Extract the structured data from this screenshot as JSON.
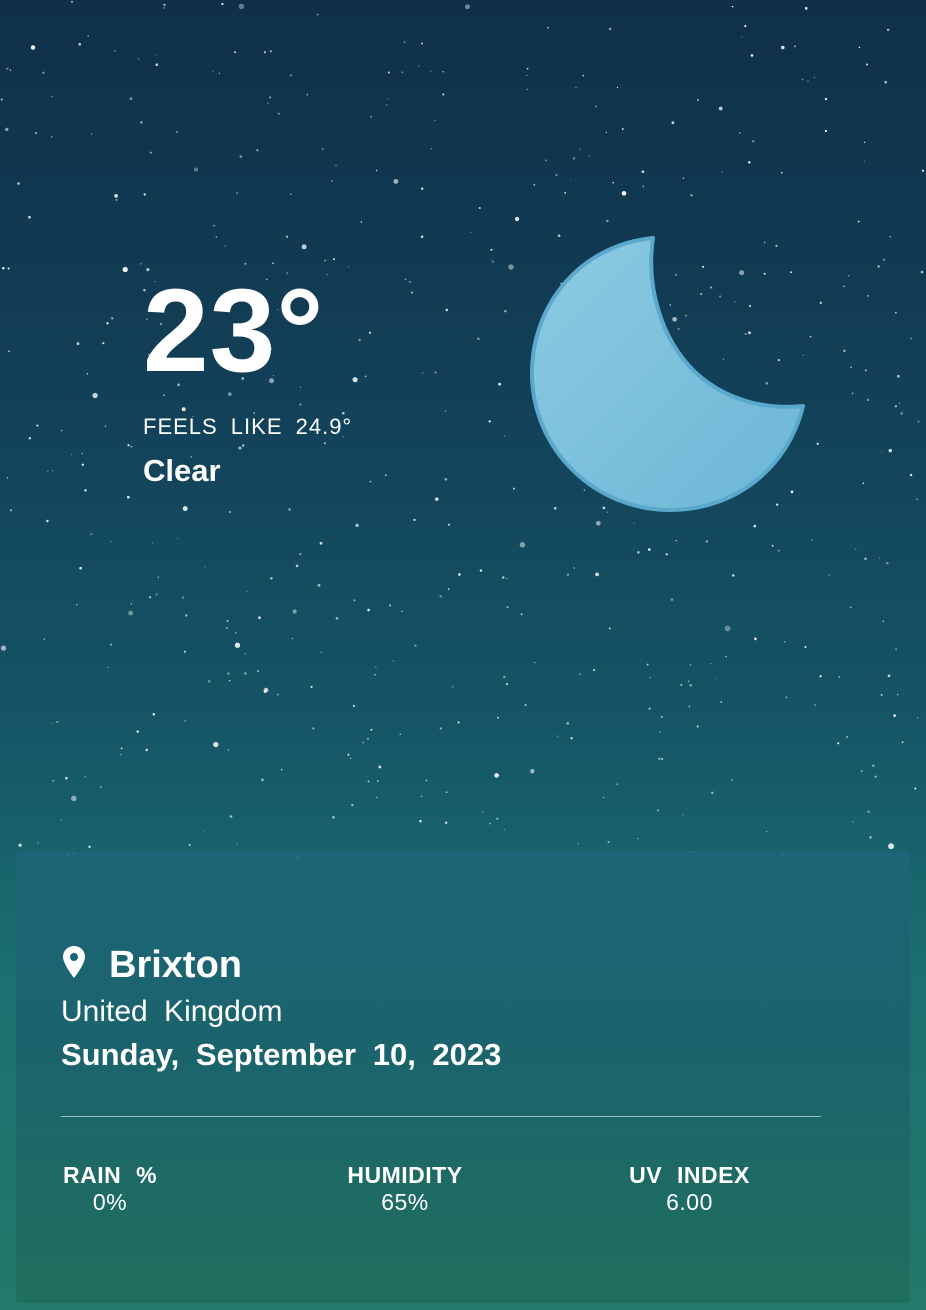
{
  "current": {
    "temperature": "23°",
    "feels_like": "FEELS LIKE 24.9°",
    "condition": "Clear",
    "icon": "crescent-moon-icon"
  },
  "location": {
    "icon": "location-pin-icon",
    "city": "Brixton",
    "country": "United Kingdom",
    "date": "Sunday, September 10, 2023"
  },
  "stats": {
    "rain_label": "RAIN %",
    "rain_value": "0%",
    "humidity_label": "HUMIDITY",
    "humidity_value": "65%",
    "uv_label": "UV INDEX",
    "uv_value": "6.00"
  },
  "colors": {
    "moon": "#7bbfda",
    "sky_top": "#0f3048",
    "sky_bottom": "#227a6a"
  }
}
